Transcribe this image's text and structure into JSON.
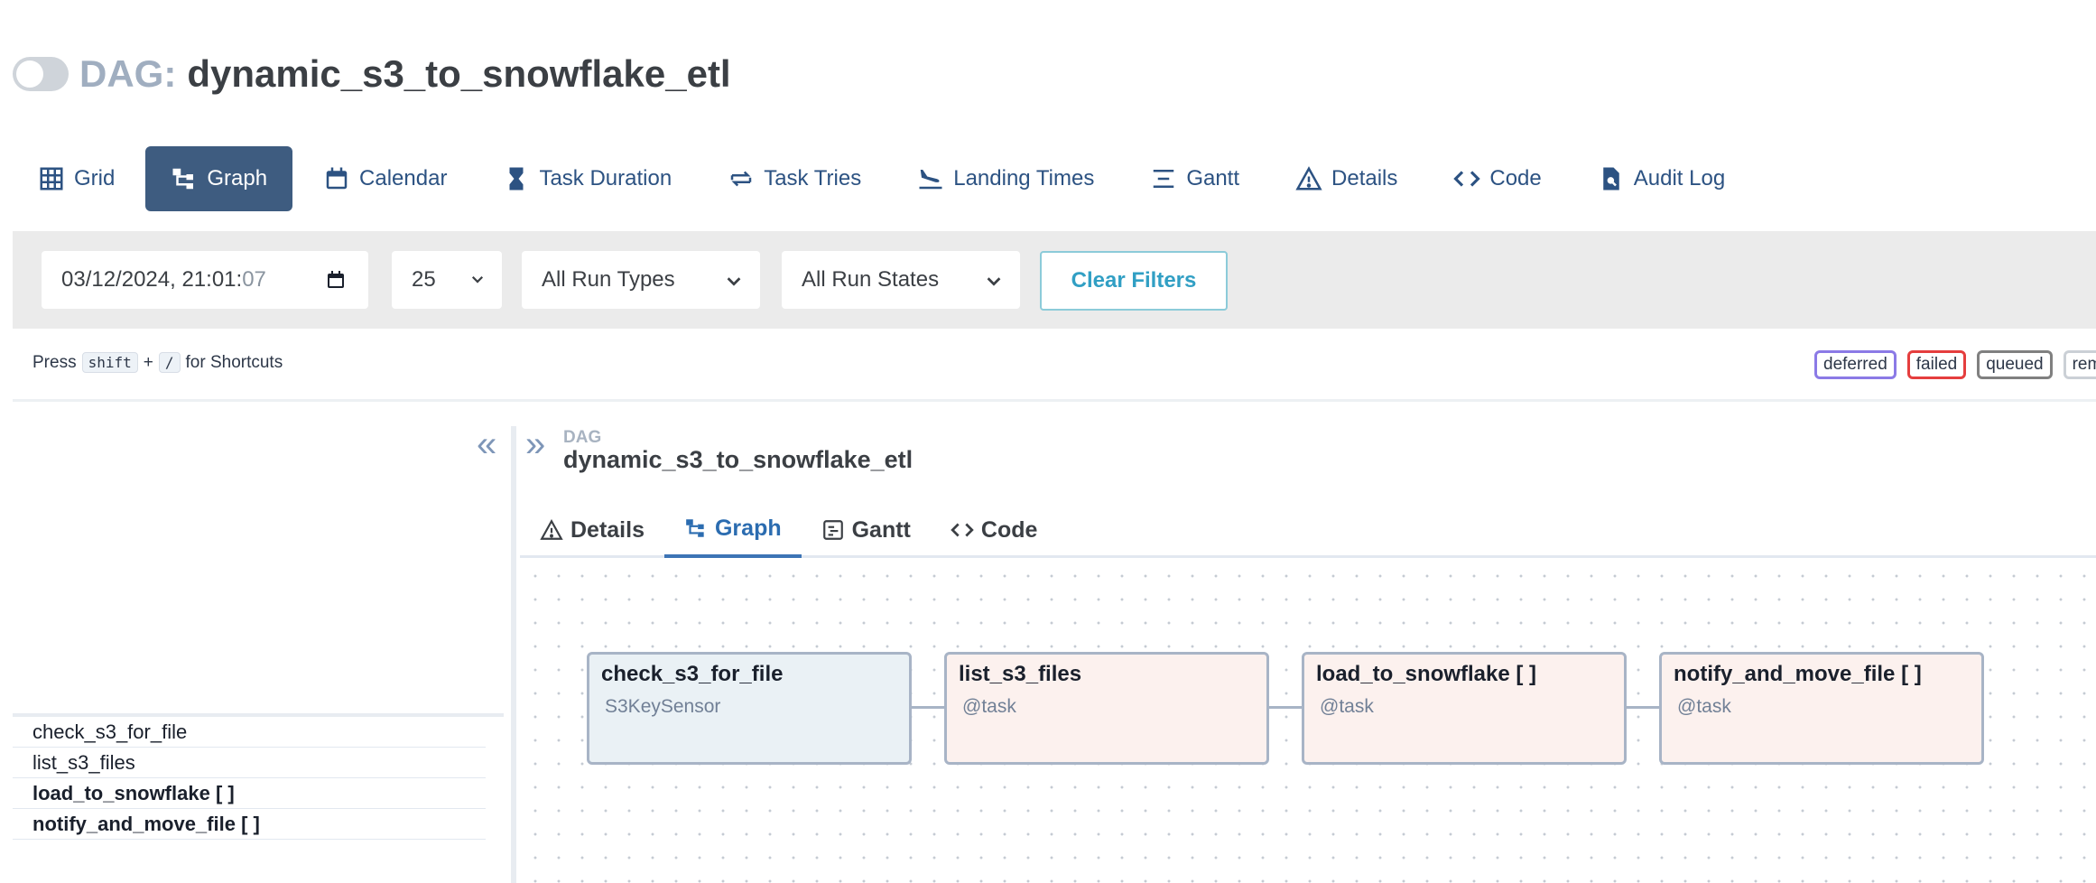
{
  "dag": {
    "prefix": "DAG:",
    "name": "dynamic_s3_to_snowflake_etl"
  },
  "nav": [
    {
      "label": "Grid",
      "icon": "grid-icon"
    },
    {
      "label": "Graph",
      "icon": "graph-icon",
      "active": true
    },
    {
      "label": "Calendar",
      "icon": "calendar-icon"
    },
    {
      "label": "Task Duration",
      "icon": "hourglass-icon"
    },
    {
      "label": "Task Tries",
      "icon": "retry-icon"
    },
    {
      "label": "Landing Times",
      "icon": "plane-landing-icon"
    },
    {
      "label": "Gantt",
      "icon": "gantt-icon"
    },
    {
      "label": "Details",
      "icon": "warning-triangle-icon"
    },
    {
      "label": "Code",
      "icon": "code-icon"
    },
    {
      "label": "Audit Log",
      "icon": "file-search-icon"
    }
  ],
  "filters": {
    "date": "03/12/2024, 21:01:",
    "date_seconds": "07",
    "num_runs": "25",
    "run_types": "All Run Types",
    "run_states": "All Run States",
    "clear": "Clear Filters"
  },
  "shortcuts": {
    "press": "Press",
    "key1": "shift",
    "plus": "+",
    "key2": "/",
    "suffix": "for Shortcuts"
  },
  "legend": [
    {
      "label": "deferred",
      "color": "#8b7ae6"
    },
    {
      "label": "failed",
      "color": "#e53e3e"
    },
    {
      "label": "queued",
      "color": "#808080"
    },
    {
      "label": "rem",
      "color": "#cbd0d6"
    }
  ],
  "tasks": [
    {
      "label": "check_s3_for_file",
      "bold": false
    },
    {
      "label": "list_s3_files",
      "bold": false
    },
    {
      "label": "load_to_snowflake [ ]",
      "bold": true
    },
    {
      "label": "notify_and_move_file [ ]",
      "bold": true
    }
  ],
  "details": {
    "crumb_label": "DAG",
    "crumb_name": "dynamic_s3_to_snowflake_etl",
    "tabs": [
      {
        "label": "Details",
        "icon": "warning-triangle-icon"
      },
      {
        "label": "Graph",
        "icon": "graph-icon",
        "active": true
      },
      {
        "label": "Gantt",
        "icon": "gantt-icon"
      },
      {
        "label": "Code",
        "icon": "code-icon"
      }
    ]
  },
  "graph": {
    "nodes": [
      {
        "name": "check_s3_for_file",
        "type": "S3KeySensor"
      },
      {
        "name": "list_s3_files",
        "type": "@task"
      },
      {
        "name": "load_to_snowflake [ ]",
        "type": "@task"
      },
      {
        "name": "notify_and_move_file [ ]",
        "type": "@task"
      }
    ]
  }
}
